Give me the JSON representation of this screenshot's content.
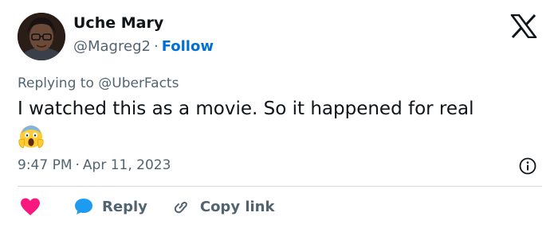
{
  "user": {
    "name": "Uche Mary",
    "handle": "@Magreg2",
    "separator": "·",
    "follow_label": "Follow"
  },
  "reply_context": {
    "prefix": "Replying to ",
    "mention": "@UberFacts"
  },
  "tweet": {
    "text": "I watched this as a movie. So it happened for real",
    "emoji": "screaming-face-emoji"
  },
  "meta": {
    "time": "9:47 PM",
    "separator": "·",
    "date": "Apr 11, 2023"
  },
  "actions": {
    "reply_label": "Reply",
    "copy_link_label": "Copy link"
  },
  "icons": {
    "brand": "x-logo-icon",
    "info": "info-icon",
    "like": "heart-icon",
    "reply": "speech-bubble-icon",
    "copy": "link-icon"
  },
  "colors": {
    "follow": "#006fd6",
    "heart": "#f91880",
    "reply_bubble": "#1d9bf0",
    "muted_text": "#536471",
    "main_text": "#0f1419"
  }
}
